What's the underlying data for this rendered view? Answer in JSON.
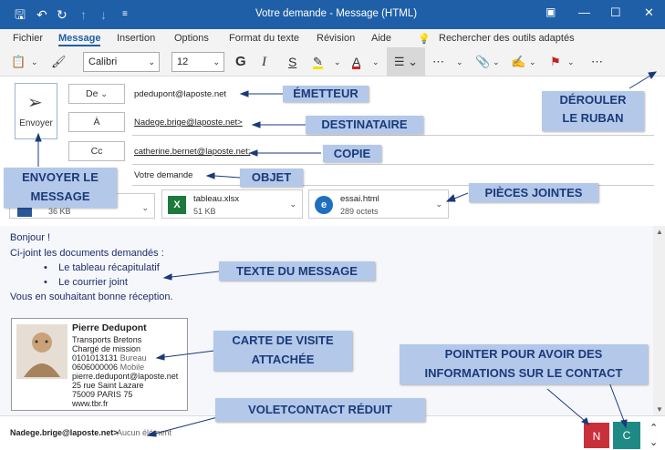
{
  "window": {
    "title": "Votre demande - Message (HTML)"
  },
  "tabs": [
    "Fichier",
    "Message",
    "Insertion",
    "Options",
    "Format du texte",
    "Révision",
    "Aide"
  ],
  "search_tools": "Rechercher des outils adaptés",
  "ribbon": {
    "font": "Calibri",
    "size": "12"
  },
  "send": {
    "label": "Envoyer"
  },
  "fields": {
    "from": {
      "button": "De",
      "value": "pdedupont@laposte.net"
    },
    "to": {
      "button": "À",
      "value": "Nadege.brige@laposte.net>"
    },
    "cc": {
      "button": "Cc",
      "value": "catherine.bernet@laposte.net;"
    },
    "subject": {
      "value": "Votre demande"
    }
  },
  "attachments": [
    {
      "name": "",
      "size": "36 KB"
    },
    {
      "name": "tableau.xlsx",
      "size": "51 KB"
    },
    {
      "name": "essai.html",
      "size": "289 octets"
    }
  ],
  "message": {
    "greeting": "Bonjour !",
    "intro": "Ci-joint les documents demandés :",
    "bullets": [
      "Le tableau récapitulatif",
      "Le courrier joint"
    ],
    "closing": "Vous en souhaitant bonne réception."
  },
  "card": {
    "name": "Pierre Dedupont",
    "company": "Transports Bretons",
    "role": "Chargé de mission",
    "phone1": "0101013131",
    "phone1_label": "Bureau",
    "phone2": "0606000006",
    "phone2_label": "Mobile",
    "email": "pierre.dedupont@laposte.net",
    "street": "25 rue Saint Lazare",
    "city": "75009  PARIS  75",
    "web": "www.tbr.fr"
  },
  "status": {
    "contact": "Nadege.brige@laposte.net>",
    "items": "Aucun élément"
  },
  "avatars": [
    {
      "letter": "N",
      "color": "#c8303a"
    },
    {
      "letter": "C",
      "color": "#1f8a85"
    }
  ],
  "annotations": {
    "emetteur": "ÉMETTEUR",
    "derouler1": "DÉROULER",
    "derouler2": "LE RUBAN",
    "destinataire": "DESTINATAIRE",
    "copie": "COPIE",
    "objet": "OBJET",
    "envoyer1": "ENVOYER LE",
    "envoyer2": "MESSAGE",
    "pieces": "PIÈCES JOINTES",
    "texte": "TEXTE DU MESSAGE",
    "carte1": "CARTE DE VISITE",
    "carte2": "ATTACHÉE",
    "pointer1": "POINTER POUR AVOIR DES",
    "pointer2": "INFORMATIONS SUR LE CONTACT",
    "volet": "VOLETCONTACT RÉDUIT"
  }
}
